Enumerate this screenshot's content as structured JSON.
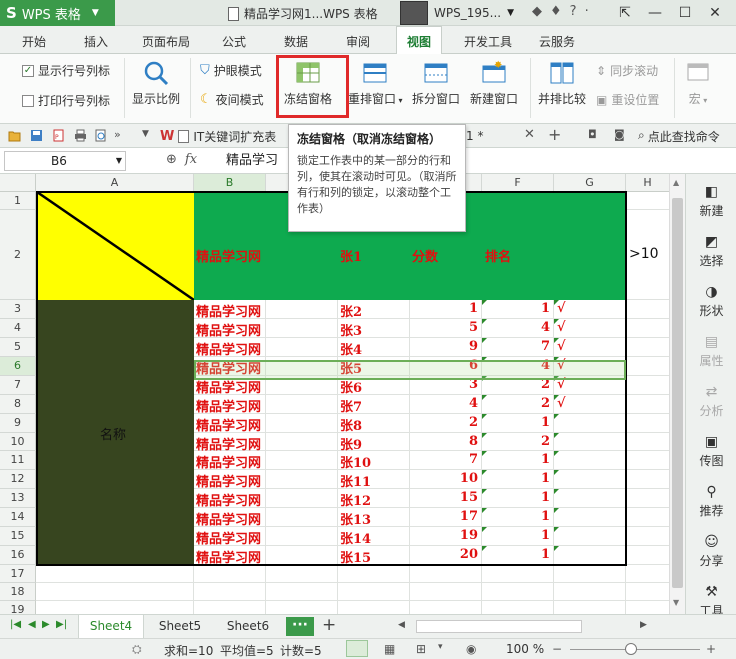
{
  "titlebar": {
    "app_name": "WPS 表格",
    "doc_title": "精品学习网1...WPS 表格",
    "user_name": "WPS_195...",
    "icons": [
      "skin-icon",
      "shirt-icon",
      "help-icon",
      "more-icon"
    ]
  },
  "menu_tabs": [
    "开始",
    "插入",
    "页面布局",
    "公式",
    "数据",
    "审阅",
    "视图",
    "开发工具",
    "云服务"
  ],
  "active_tab": "视图",
  "ribbon": {
    "show_row_col_headers": "显示行号列标",
    "print_row_col_headers": "打印行号列标",
    "zoom_label": "显示比例",
    "eye_protect": "护眼模式",
    "night_mode": "夜间模式",
    "freeze_panes": "冻结窗格",
    "arrange_windows": "重排窗口",
    "split_window": "拆分窗口",
    "new_window": "新建窗口",
    "side_by_side": "并排比较",
    "sync_scroll": "同步滚动",
    "reset_position": "重设位置",
    "macro": "宏"
  },
  "quickaccess": {
    "tab1": "IT关键词扩充表",
    "tab2_suffix": "1 *",
    "find_command": "点此查找命令"
  },
  "formula_bar": {
    "cell_ref": "B6",
    "fx": "fx",
    "content": "精品学习"
  },
  "tooltip": {
    "title": "冻结窗格（取消冻结窗格）",
    "body": "锁定工作表中的某一部分的行和列，使其在滚动时可见。（取消所有行和列的锁定，以滚动整个工作表）"
  },
  "sheet": {
    "columns": [
      "A",
      "B",
      "C",
      "D",
      "E",
      "F",
      "G",
      "H"
    ],
    "rows": [
      "1",
      "2",
      "3",
      "4",
      "5",
      "6",
      "7",
      "8",
      "9",
      "10",
      "11",
      "12",
      "13",
      "14",
      "15",
      "16",
      "17",
      "18",
      "19"
    ],
    "header_row": {
      "b": "精品学习网",
      "d": "张1",
      "e": "分数",
      "f": "排名",
      "h": ">10"
    },
    "a_label": "名称",
    "data_rows": [
      {
        "b": "精品学习网",
        "d": "张2",
        "e": "1",
        "f": "1",
        "g": "√"
      },
      {
        "b": "精品学习网",
        "d": "张3",
        "e": "5",
        "f": "4",
        "g": "√"
      },
      {
        "b": "精品学习网",
        "d": "张4",
        "e": "9",
        "f": "7",
        "g": "√"
      },
      {
        "b": "精品学习网",
        "d": "张5",
        "e": "6",
        "f": "4",
        "g": "√"
      },
      {
        "b": "精品学习网",
        "d": "张6",
        "e": "3",
        "f": "2",
        "g": "√"
      },
      {
        "b": "精品学习网",
        "d": "张7",
        "e": "4",
        "f": "2",
        "g": "√"
      },
      {
        "b": "精品学习网",
        "d": "张8",
        "e": "2",
        "f": "1",
        "g": ""
      },
      {
        "b": "精品学习网",
        "d": "张9",
        "e": "8",
        "f": "2",
        "g": ""
      },
      {
        "b": "精品学习网",
        "d": "张10",
        "e": "7",
        "f": "1",
        "g": ""
      },
      {
        "b": "精品学习网",
        "d": "张11",
        "e": "10",
        "f": "1",
        "g": ""
      },
      {
        "b": "精品学习网",
        "d": "张12",
        "e": "15",
        "f": "1",
        "g": ""
      },
      {
        "b": "精品学习网",
        "d": "张13",
        "e": "17",
        "f": "1",
        "g": ""
      },
      {
        "b": "精品学习网",
        "d": "张14",
        "e": "19",
        "f": "1",
        "g": ""
      },
      {
        "b": "精品学习网",
        "d": "张15",
        "e": "20",
        "f": "1",
        "g": ""
      }
    ]
  },
  "right_pane": [
    "新建",
    "选择",
    "形状",
    "属性",
    "分析",
    "传图",
    "推荐",
    "分享",
    "工具"
  ],
  "sheet_tabs": [
    "Sheet4",
    "Sheet5",
    "Sheet6"
  ],
  "more_tabs": "···",
  "add_sheet": "+",
  "status": {
    "sum": "求和=10",
    "avg": "平均值=5",
    "count": "计数=5",
    "zoom": "100 %"
  },
  "colors": {
    "wps_green": "#3b9a4a",
    "header_band": "#0eaa4f",
    "yellow": "#ffff00",
    "dark_block": "#37451f",
    "red_text": "#e01010",
    "freeze_highlight": "#e02a2a"
  }
}
